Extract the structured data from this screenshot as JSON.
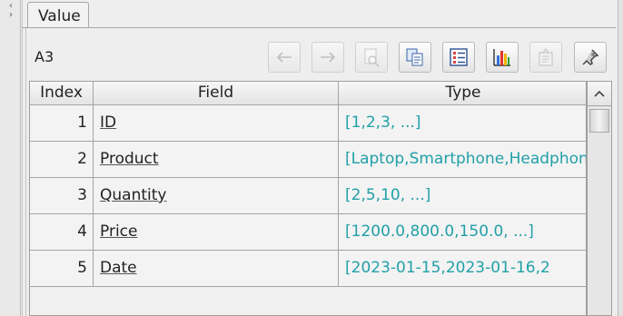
{
  "tab": {
    "label": "Value"
  },
  "cell_name": "A3",
  "toolbar": {
    "buttons": [
      "back-icon",
      "forward-icon",
      "preview-icon",
      "copy-icon",
      "list-icon",
      "chart-icon",
      "export-icon",
      "pin-icon"
    ]
  },
  "table": {
    "headers": [
      "Index",
      "Field",
      "Type"
    ],
    "rows": [
      {
        "index": "1",
        "field": "ID",
        "type": "[1,2,3, ...]"
      },
      {
        "index": "2",
        "field": "Product",
        "type": "[Laptop,Smartphone,Headphones"
      },
      {
        "index": "3",
        "field": "Quantity",
        "type": "[2,5,10, ...]"
      },
      {
        "index": "4",
        "field": "Price",
        "type": "[1200.0,800.0,150.0, ...]"
      },
      {
        "index": "5",
        "field": "Date",
        "type": "[2023-01-15,2023-01-16,2"
      }
    ]
  },
  "colors": {
    "value_text": "#22a0a8"
  }
}
